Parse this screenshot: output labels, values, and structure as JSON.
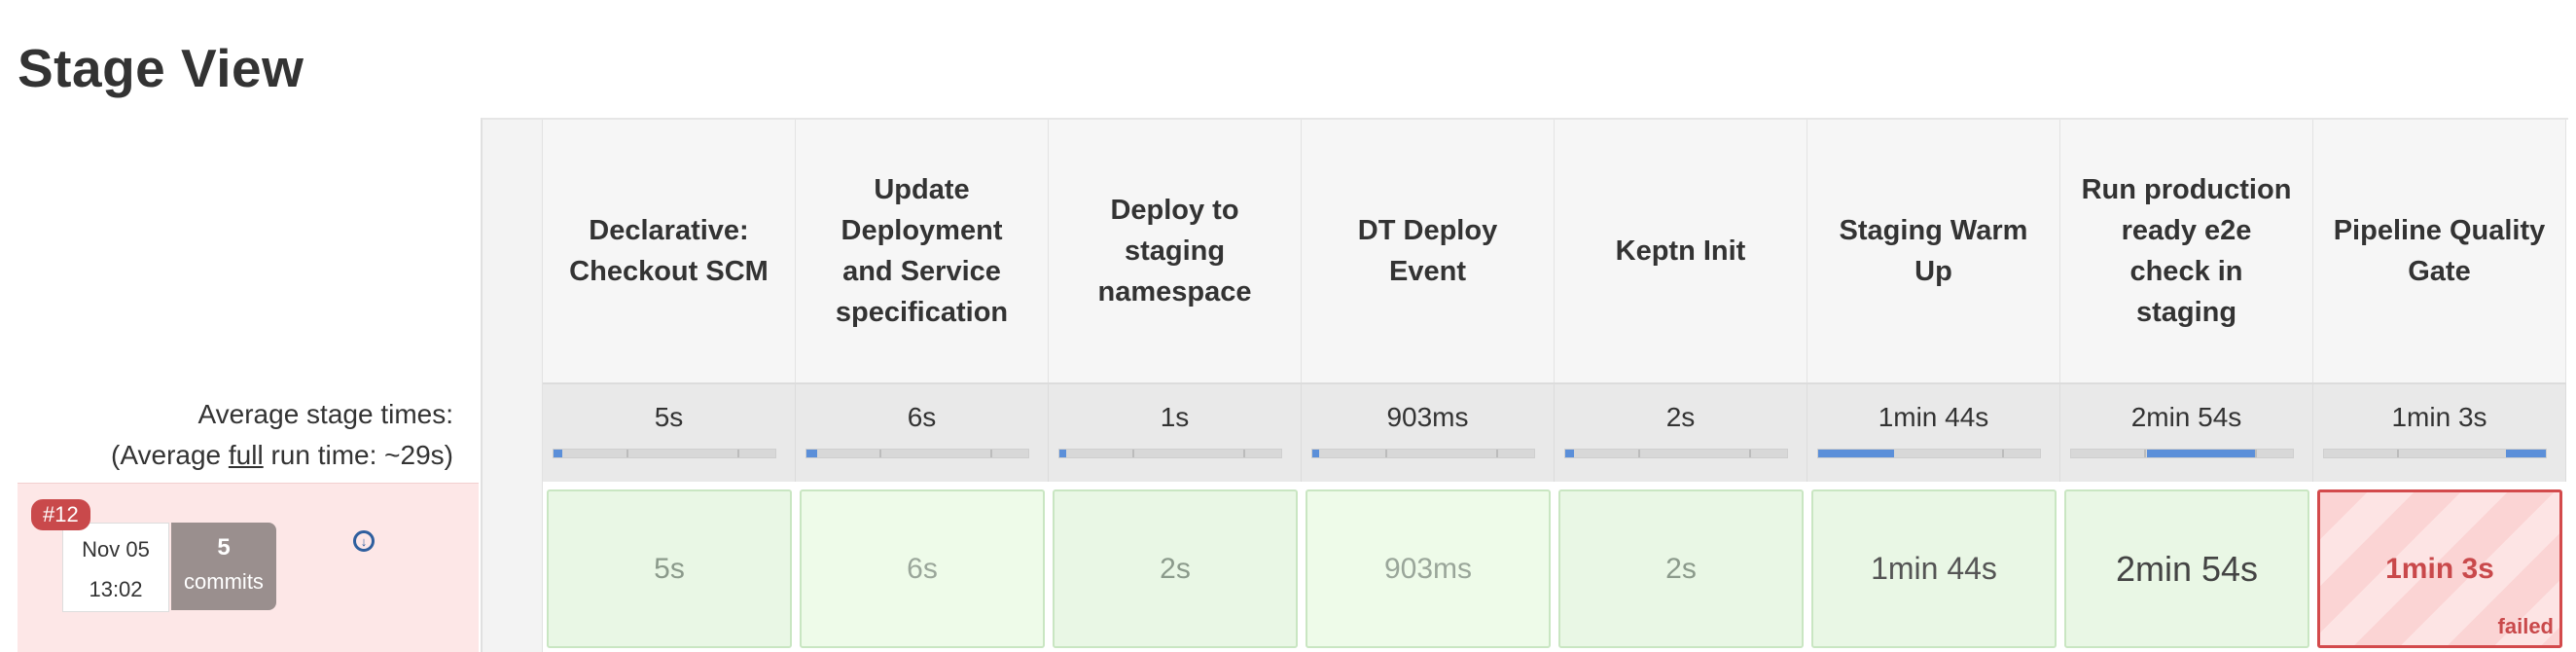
{
  "page": {
    "title": "Stage View"
  },
  "summary": {
    "avg_stage_label": "Average stage times:",
    "avg_full_prefix": "(Average ",
    "avg_full_word": "full",
    "avg_full_suffix": " run time: ~29s)"
  },
  "run": {
    "badge": "#12",
    "date": "Nov 05",
    "time": "13:02",
    "commits_count": "5",
    "commits_label": "commits"
  },
  "stages": [
    {
      "name": "Declarative: Checkout SCM",
      "avg": "5s",
      "progress": {
        "start": 0.0,
        "end": 0.04
      },
      "run_time": "5s",
      "status": "success",
      "tone": "normal"
    },
    {
      "name": "Update Deployment and Service specification",
      "avg": "6s",
      "progress": {
        "start": 0.0,
        "end": 0.05
      },
      "run_time": "6s",
      "status": "success",
      "tone": "fast"
    },
    {
      "name": "Deploy to staging namespace",
      "avg": "1s",
      "progress": {
        "start": 0.0,
        "end": 0.03
      },
      "run_time": "2s",
      "status": "success",
      "tone": "normal"
    },
    {
      "name": "DT Deploy Event",
      "avg": "903ms",
      "progress": {
        "start": 0.0,
        "end": 0.03
      },
      "run_time": "903ms",
      "status": "success",
      "tone": "fast"
    },
    {
      "name": "Keptn Init",
      "avg": "2s",
      "progress": {
        "start": 0.0,
        "end": 0.04
      },
      "run_time": "2s",
      "status": "success",
      "tone": "normal"
    },
    {
      "name": "Staging Warm Up",
      "avg": "1min 44s",
      "progress": {
        "start": 0.0,
        "end": 0.34
      },
      "run_time": "1min 44s",
      "status": "success",
      "tone": "slow"
    },
    {
      "name": "Run production ready e2e check in staging",
      "avg": "2min 54s",
      "progress": {
        "start": 0.34,
        "end": 0.83
      },
      "run_time": "2min 54s",
      "status": "success",
      "tone": "slower"
    },
    {
      "name": "Pipeline Quality Gate",
      "avg": "1min 3s",
      "progress": {
        "start": 0.82,
        "end": 1.0
      },
      "run_time": "1min 3s",
      "status": "failed",
      "status_label": "failed",
      "tone": "normal"
    }
  ],
  "icons": {
    "download": "download-icon"
  },
  "colors": {
    "failed": "#c9494b",
    "success_bg": "#e9f7e5",
    "progress_fill": "#5b8fd9"
  }
}
